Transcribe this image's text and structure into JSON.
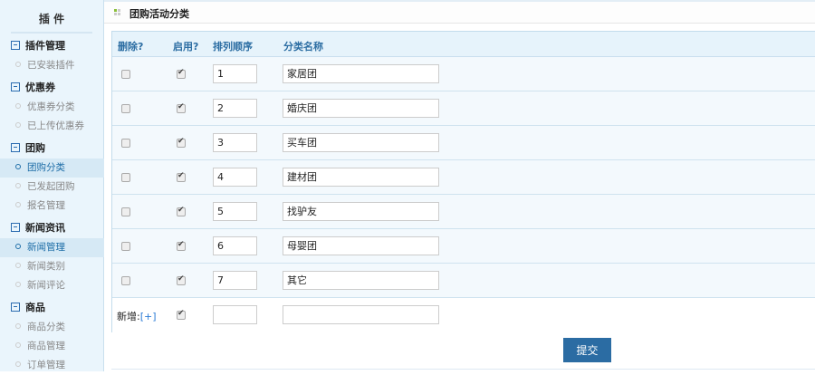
{
  "sidebar": {
    "title": "插 件",
    "groups": [
      {
        "label": "插件管理",
        "items": [
          {
            "label": "已安装插件"
          }
        ]
      },
      {
        "label": "优惠券",
        "items": [
          {
            "label": "优惠券分类"
          },
          {
            "label": "已上传优惠券"
          }
        ]
      },
      {
        "label": "团购",
        "items": [
          {
            "label": "团购分类",
            "active": true
          },
          {
            "label": "已发起团购"
          },
          {
            "label": "报名管理"
          }
        ]
      },
      {
        "label": "新闻资讯",
        "items": [
          {
            "label": "新闻管理",
            "active": true
          },
          {
            "label": "新闻类别"
          },
          {
            "label": "新闻评论"
          }
        ]
      },
      {
        "label": "商品",
        "items": [
          {
            "label": "商品分类"
          },
          {
            "label": "商品管理"
          },
          {
            "label": "订单管理"
          }
        ]
      }
    ]
  },
  "page": {
    "title": "团购活动分类"
  },
  "table": {
    "headers": [
      "删除?",
      "启用?",
      "排列顺序",
      "分类名称"
    ],
    "rows": [
      {
        "delete": false,
        "enabled": true,
        "order": "1",
        "name": "家居团"
      },
      {
        "delete": false,
        "enabled": true,
        "order": "2",
        "name": "婚庆团"
      },
      {
        "delete": false,
        "enabled": true,
        "order": "3",
        "name": "买车团"
      },
      {
        "delete": false,
        "enabled": true,
        "order": "4",
        "name": "建材团"
      },
      {
        "delete": false,
        "enabled": true,
        "order": "5",
        "name": "找驴友"
      },
      {
        "delete": false,
        "enabled": true,
        "order": "6",
        "name": "母婴团"
      },
      {
        "delete": false,
        "enabled": true,
        "order": "7",
        "name": "其它"
      }
    ],
    "new_row": {
      "label": "新增:",
      "add_link": "[+]",
      "enabled": true,
      "order": "",
      "name": ""
    }
  },
  "submit_label": "提交"
}
